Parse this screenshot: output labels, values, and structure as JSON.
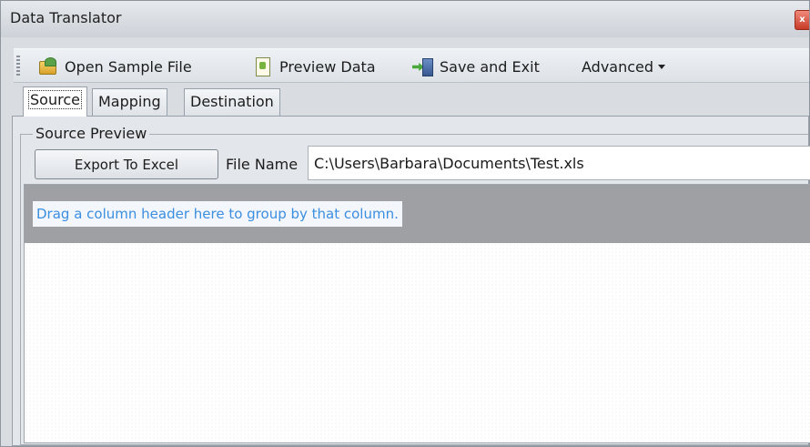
{
  "window": {
    "title": "Data Translator",
    "close_symbol": "x"
  },
  "toolbar": {
    "items": [
      {
        "label": "Open Sample File",
        "icon": "open-sample-file-icon"
      },
      {
        "label": "Preview Data",
        "icon": "preview-data-icon"
      },
      {
        "label": "Save and Exit",
        "icon": "save-and-exit-icon"
      },
      {
        "label": "Advanced",
        "icon": "chevron-down-icon"
      }
    ]
  },
  "tabs": {
    "items": [
      {
        "label": "Source",
        "active": true
      },
      {
        "label": "Mapping",
        "active": false
      },
      {
        "label": "Destination",
        "active": false
      }
    ]
  },
  "source_preview": {
    "legend": "Source Preview",
    "export_button_label": "Export To Excel",
    "file_name_label": "File Name",
    "file_name_value": "C:\\Users\\Barbara\\Documents\\Test.xls"
  },
  "grid": {
    "group_hint": "Drag a column header here to group by that column."
  },
  "colors": {
    "hint_text": "#3b8ee0",
    "group_panel": "#9ea0a3",
    "window_bg": "#d9dde2"
  }
}
